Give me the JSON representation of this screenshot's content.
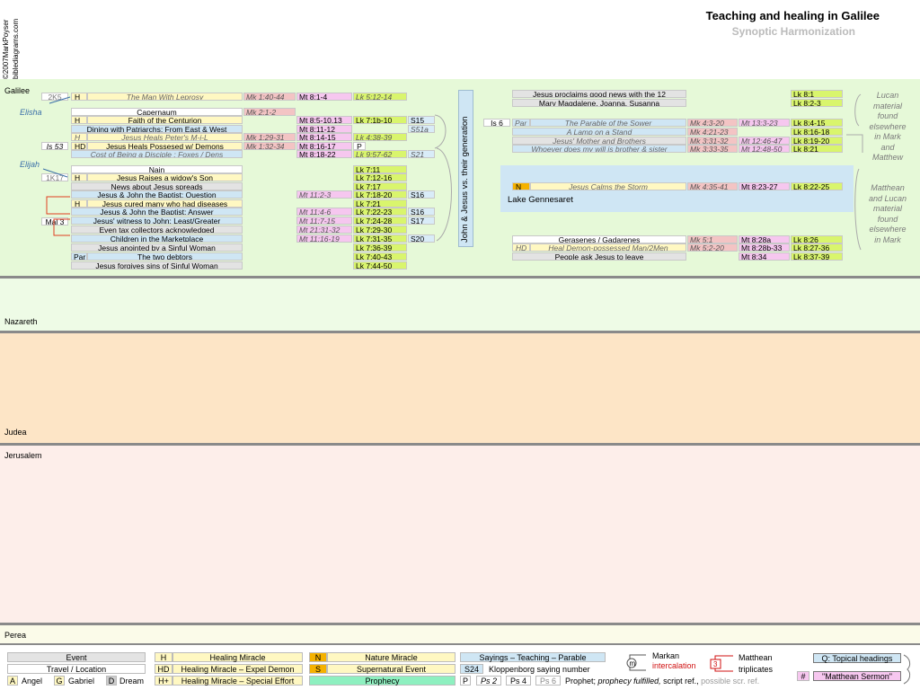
{
  "header": {
    "title": "Teaching and healing in Galilee",
    "subtitle": "Synoptic Harmonization",
    "copyright": "©2007MarkPoyser",
    "site": "biblediagrams.com"
  },
  "regions": {
    "galilee": "Galilee",
    "nazareth": "Nazareth",
    "judea": "Judea",
    "jerusalem": "Jerusalem",
    "perea": "Perea"
  },
  "left_notes": {
    "two_k5": "2K5",
    "elisha": "Elisha",
    "is53": "Is 53",
    "elijah": "Elijah",
    "one_k17": "1K17",
    "mal3": "Mal 3"
  },
  "events_left": [
    {
      "tag": "H",
      "event": "The Man With Leprosy",
      "mk": "Mk 1:40-44",
      "mt": "Mt 8:1-4",
      "lk": "Lk 5:12-14",
      "s": ""
    },
    {
      "tag": "",
      "event": "Capernaum",
      "mk": "Mk 2:1-2",
      "mt": "",
      "lk": "",
      "s": ""
    },
    {
      "tag": "H",
      "event": "Faith of the Centurion",
      "mk": "",
      "mt": "Mt 8:5-10,13",
      "lk": "Lk 7:1b-10",
      "s": "S15"
    },
    {
      "tag": "",
      "event": "Dining with Patriarchs; From East & West",
      "mk": "",
      "mt": "Mt 8:11-12",
      "lk": "",
      "s": "S51a"
    },
    {
      "tag": "H",
      "event": "Jesus Heals Peter's M-i-L",
      "mk": "Mk 1:29-31",
      "mt": "Mt 8:14-15",
      "lk": "Lk 4:38-39",
      "s": ""
    },
    {
      "tag": "HD",
      "event": "Jesus Heals Possesed w/ Demons",
      "mk": "Mk 1:32-34",
      "mt": "Mt 8:16-17",
      "lk": "",
      "s": "P"
    },
    {
      "tag": "",
      "event": "Cost of Being a Disciple : Foxes / Dens",
      "mk": "",
      "mt": "Mt 8:18-22",
      "lk": "Lk 9:57-62",
      "s": "S21"
    },
    {
      "tag": "",
      "event": "Nain",
      "mk": "",
      "mt": "",
      "lk": "Lk 7:11",
      "s": ""
    },
    {
      "tag": "H",
      "event": "Jesus Raises a widow's Son",
      "mk": "",
      "mt": "",
      "lk": "Lk 7:12-16",
      "s": ""
    },
    {
      "tag": "",
      "event": "News about Jesus spreads",
      "mk": "",
      "mt": "",
      "lk": "Lk 7:17",
      "s": ""
    },
    {
      "tag": "",
      "event": "Jesus & John the Baptist: Question",
      "mk": "",
      "mt": "Mt 11:2-3",
      "lk": "Lk 7:18-20",
      "s": "S16"
    },
    {
      "tag": "H",
      "event": "Jesus cured many who had diseases",
      "mk": "",
      "mt": "",
      "lk": "Lk 7:21",
      "s": ""
    },
    {
      "tag": "",
      "event": "Jesus & John the Baptist: Answer",
      "mk": "",
      "mt": "Mt 11:4-6",
      "lk": "Lk 7:22-23",
      "s": "S16"
    },
    {
      "tag": "",
      "event": "Jesus' witness to John: Least/Greater",
      "mk": "",
      "mt": "Mt 11:7-15",
      "lk": "Lk 7:24-28",
      "s": "S17"
    },
    {
      "tag": "",
      "event": "Even tax collectors acknowledged",
      "mk": "",
      "mt": "Mt 21:31-32",
      "lk": "Lk 7:29-30",
      "s": ""
    },
    {
      "tag": "",
      "event": "Children in the Marketplace",
      "mk": "",
      "mt": "Mt 11:16-19",
      "lk": "Lk 7:31-35",
      "s": "S20"
    },
    {
      "tag": "",
      "event": "Jesus anointed by a Sinful Woman",
      "mk": "",
      "mt": "",
      "lk": "Lk 7:36-39",
      "s": ""
    },
    {
      "tag": "Par",
      "event": "The two debtors",
      "mk": "",
      "mt": "",
      "lk": "Lk 7:40-43",
      "s": ""
    },
    {
      "tag": "",
      "event": "Jesus forgives sins of Sinful Woman",
      "mk": "",
      "mt": "",
      "lk": "Lk 7:44-50",
      "s": ""
    }
  ],
  "vertical_heading": "John & Jesus vs. their generation",
  "events_right": [
    {
      "event": "Jesus proclaims good news with the 12",
      "lk": "Lk 8:1"
    },
    {
      "event": "Mary Magdalene, Joanna, Susanna",
      "lk": "Lk 8:2-3"
    },
    {
      "ref": "Is 6",
      "tag": "Par",
      "event": "The Parable of the Sower",
      "mk": "Mk 4:3-20",
      "mt": "Mt 13:3-23",
      "lk": "Lk 8:4-15"
    },
    {
      "event": "A Lamp on a Stand",
      "mk": "Mk 4:21-23",
      "mt": "",
      "lk": "Lk 8:16-18"
    },
    {
      "event": "Jesus' Mother and Brothers",
      "mk": "Mk 3:31-32",
      "mt": "Mt 12:46-47",
      "lk": "Lk 8:19-20"
    },
    {
      "event": "Whoever does my will is brother & sister",
      "mk": "Mk 3:33-35",
      "mt": "Mt 12:48-50",
      "lk": "Lk 8:21"
    },
    {
      "tag": "N",
      "event": "Jesus Calms the Storm",
      "mk": "Mk 4:35-41",
      "mt": "Mt 8:23-27",
      "lk": "Lk 8:22-25"
    },
    {
      "event": "Gerasenes / Gadarenes",
      "mk": "Mk 5:1",
      "mt": "Mt 8:28a",
      "lk": "Lk 8:26"
    },
    {
      "tag": "HD",
      "event": "Heal Demon-possessed Man/2Men",
      "mk": "Mk 5:2-20",
      "mt": "Mt 8:28b-33",
      "lk": "Lk 8:27-36"
    },
    {
      "event": "People ask Jesus to leave",
      "mk": "",
      "mt": "Mt 8:34",
      "lk": "Lk 8:37-39"
    }
  ],
  "lake_label": "Lake Gennesaret",
  "side_notes": {
    "lucan": [
      "Lucan",
      "material",
      "found",
      "elsewhere",
      "in Mark",
      "and",
      "Matthew"
    ],
    "matthean": [
      "Matthean",
      "and Lucan",
      "material",
      "found",
      "elsewhere",
      "in Mark"
    ]
  },
  "legend": {
    "event": "Event",
    "travel": "Travel / Location",
    "angel_tag": "A",
    "angel": "Angel",
    "gabriel_tag": "G",
    "gabriel": "Gabriel",
    "dream_tag": "D",
    "dream": "Dream",
    "h_tag": "H",
    "healing": "Healing Miracle",
    "hd_tag": "HD",
    "healing_demon": "Healing Miracle – Expel Demon",
    "hplus_tag": "H+",
    "healing_special": "Healing Miracle – Special Effort",
    "n_tag": "N",
    "nature": "Nature Miracle",
    "s_tag": "S",
    "supernatural": "Supernatural Event",
    "prophecy": "Prophecy",
    "sayings": "Sayings – Teaching – Parable",
    "s24": "S24",
    "kloppenborg": "Kloppenborg saying number",
    "p": "P",
    "ps2": "Ps 2",
    "ps4": "Ps 4",
    "ps6": "Ps 6",
    "prophet_line_1": "Prophet;",
    "prophet_line_2": "prophecy fulfilled,",
    "prophet_line_3": "script ref.,",
    "prophet_line_4": "possible scr. ref.",
    "markan": "Markan",
    "intercalation": "intercalation",
    "matthean": "Matthean",
    "triplicates": "triplicates",
    "triplicate_num": "3",
    "q_headings": "Q: Topical headings",
    "hash": "#",
    "matthean_sermon": "\"Matthean Sermon\""
  },
  "colors": {
    "galilee": "#e6f9d8",
    "nazareth": "#eefbe6",
    "judea": "#fde5c6",
    "jerusalem": "#fdeeea",
    "perea": "#fbfbe9",
    "vertical_box": "#cfe6f4",
    "lake": "#cfe6f4",
    "lk": "#d9f56d",
    "mt": "#f6c7ef",
    "mk": "#f3c4c4"
  }
}
